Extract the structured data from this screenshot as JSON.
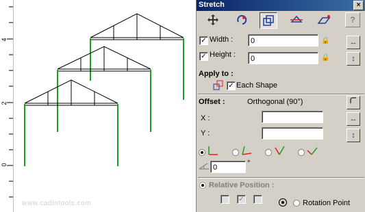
{
  "canvas": {
    "ruler_labels": [
      "4",
      "2",
      "0"
    ],
    "watermark": "www.cadintools.com"
  },
  "dialog": {
    "title": "Stretch",
    "close": "×",
    "help": "?",
    "toolbar": [
      "move-icon",
      "rotate-icon",
      "stretch-icon",
      "mirror-icon",
      "slant-icon"
    ],
    "width": {
      "label": "Width :",
      "value": "0",
      "checked": true
    },
    "height": {
      "label": "Height :",
      "value": "0",
      "checked": true
    },
    "apply_to": {
      "label": "Apply to :",
      "option": "Each Shape",
      "checked": true
    },
    "offset": {
      "label": "Offset :",
      "mode": "Orthogonal (90°)"
    },
    "x": {
      "label": "X :",
      "value": ""
    },
    "y": {
      "label": "Y :",
      "value": ""
    },
    "angle": {
      "value": "0",
      "unit": "°"
    },
    "relative_position": {
      "label": "Relative Position :"
    },
    "rotation_point": {
      "label": "Rotation Point"
    },
    "colors": {
      "titlebar": "#0a246a",
      "panel": "#d4d0c8",
      "frame_green": "#1aa01a"
    }
  }
}
